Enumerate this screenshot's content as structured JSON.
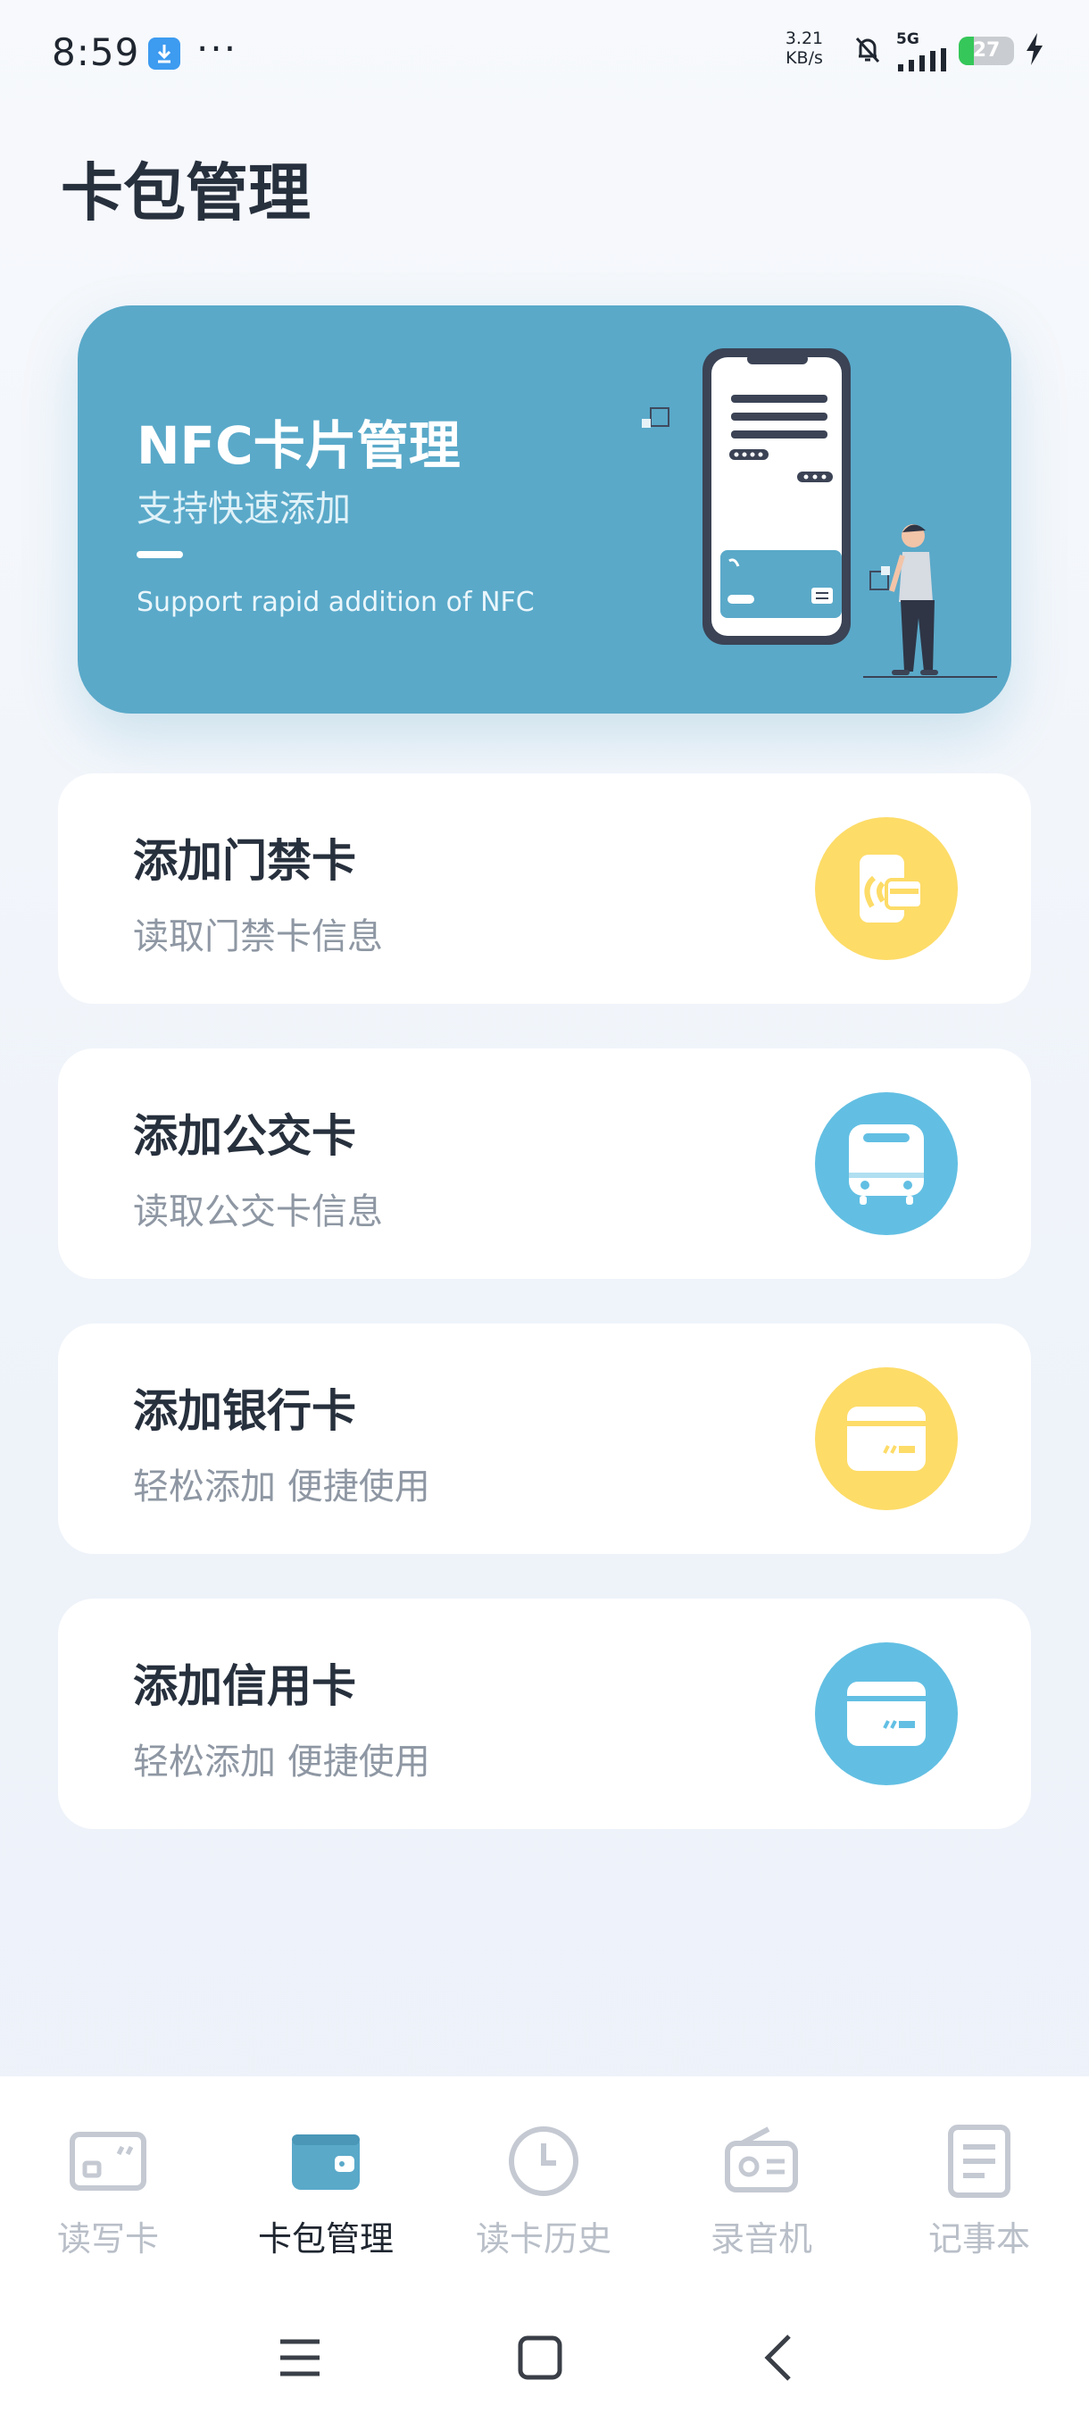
{
  "status_bar": {
    "time": "8:59",
    "dots": "···",
    "speed_value": "3.21",
    "speed_unit": "KB/s",
    "network": "5G",
    "battery": "27"
  },
  "page": {
    "title": "卡包管理"
  },
  "banner": {
    "title": "NFC卡片管理",
    "subtitle": "支持快速添加",
    "english": "Support rapid addition of NFC"
  },
  "cards": [
    {
      "title": "添加门禁卡",
      "subtitle": "读取门禁卡信息",
      "icon": "door-card-icon",
      "color": "#fddc68"
    },
    {
      "title": "添加公交卡",
      "subtitle": "读取公交卡信息",
      "icon": "bus-icon",
      "color": "#62bfe3"
    },
    {
      "title": "添加银行卡",
      "subtitle": "轻松添加 便捷使用",
      "icon": "bank-card-icon",
      "color": "#fddc68"
    },
    {
      "title": "添加信用卡",
      "subtitle": "轻松添加 便捷使用",
      "icon": "credit-card-icon",
      "color": "#62bfe3"
    }
  ],
  "nav": {
    "items": [
      {
        "label": "读写卡",
        "icon": "read-write-card-icon",
        "active": false
      },
      {
        "label": "卡包管理",
        "icon": "wallet-icon",
        "active": true
      },
      {
        "label": "读卡历史",
        "icon": "clock-icon",
        "active": false
      },
      {
        "label": "录音机",
        "icon": "radio-icon",
        "active": false
      },
      {
        "label": "记事本",
        "icon": "notepad-icon",
        "active": false
      }
    ]
  },
  "colors": {
    "banner": "#5aa9c9",
    "yellow": "#fddc68",
    "blue": "#62bfe3",
    "nav_active": "#5aa9c9",
    "nav_inactive": "#c4c9d2"
  }
}
